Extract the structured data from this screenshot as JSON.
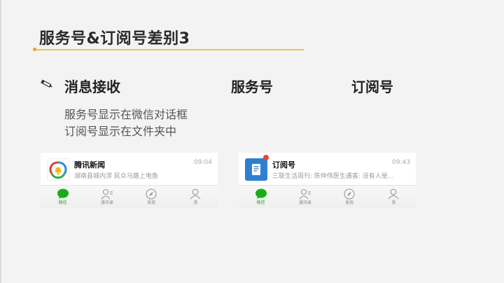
{
  "slide": {
    "title": "服务号&订阅号差别3",
    "section_heading": "消息接收",
    "columns": [
      "服务号",
      "订阅号"
    ],
    "descriptions": [
      "服务号显示在微信对话框",
      "订阅号显示在文件夹中"
    ],
    "accent_color": "#f0c04a"
  },
  "cards": [
    {
      "chat": {
        "name": "腾讯新闻",
        "message": "湖南县城内涝 民众马路上电鱼",
        "time": "09:04",
        "avatar_icon": "tencent-news-icon"
      },
      "tabs": [
        {
          "label": "微信",
          "icon": "chat-bubble-icon",
          "active": true
        },
        {
          "label": "通讯录",
          "icon": "contacts-icon",
          "active": false
        },
        {
          "label": "发现",
          "icon": "compass-icon",
          "active": false
        },
        {
          "label": "我",
          "icon": "person-icon",
          "active": false
        }
      ]
    },
    {
      "chat": {
        "name": "订阅号",
        "message": "三联生活周刊: 陈仲伟医生遇害: 没有人是...",
        "time": "09:43",
        "avatar_icon": "subscription-folder-icon"
      },
      "tabs": [
        {
          "label": "微信",
          "icon": "chat-bubble-icon",
          "active": true
        },
        {
          "label": "通讯录",
          "icon": "contacts-icon",
          "active": false
        },
        {
          "label": "发现",
          "icon": "compass-icon",
          "active": false
        },
        {
          "label": "我",
          "icon": "person-icon",
          "active": false
        }
      ]
    }
  ],
  "colors": {
    "wechat_green": "#1aad19",
    "unread_red": "#e64340",
    "subscription_blue": "#2f7fd1"
  }
}
